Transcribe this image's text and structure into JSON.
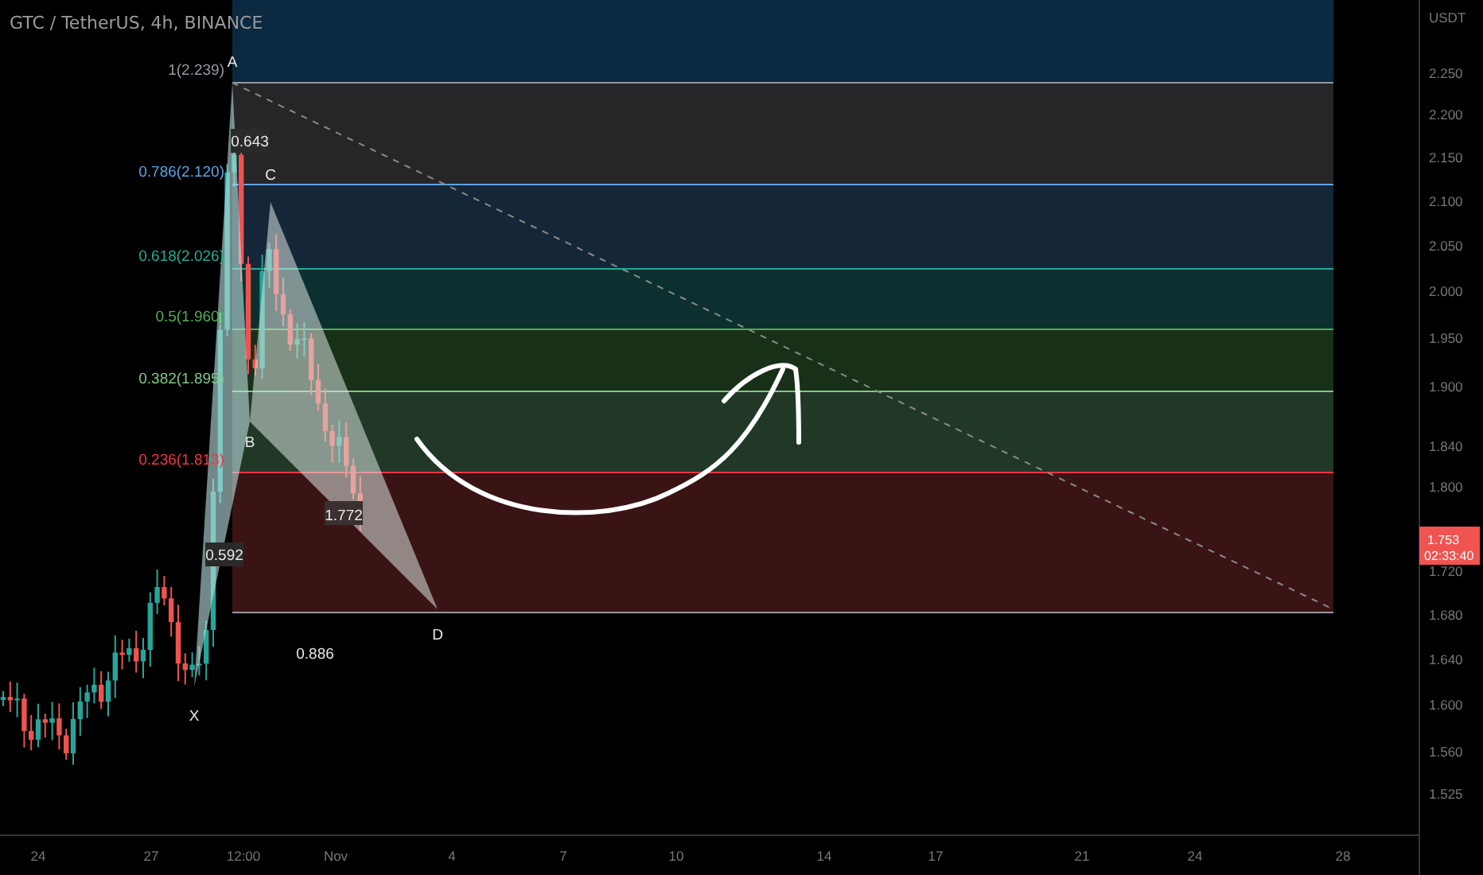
{
  "header": {
    "symbol": "GTC / TetherUS, 4h, BINANCE"
  },
  "price_axis": {
    "unit": "USDT",
    "ticks": [
      "2.250",
      "2.200",
      "2.150",
      "2.100",
      "2.050",
      "2.000",
      "1.950",
      "1.900",
      "1.840",
      "1.800",
      "1.720",
      "1.680",
      "1.640",
      "1.600",
      "1.560",
      "1.525"
    ],
    "last_price": {
      "value": "1.753",
      "countdown": "02:33:40",
      "color": "#f05350"
    }
  },
  "time_axis": {
    "ticks": [
      "24",
      "27",
      "12:00",
      "Nov",
      "4",
      "7",
      "10",
      "14",
      "17",
      "21",
      "24",
      "28"
    ]
  },
  "fib_levels": [
    {
      "label": "1(2.239)",
      "color": "#9598a1"
    },
    {
      "label": "0.786(2.120)",
      "color": "#5ba4e6"
    },
    {
      "label": "0.618(2.026)",
      "color": "#22ab94"
    },
    {
      "label": "0.5(1.960)",
      "color": "#4caf50"
    },
    {
      "label": "0.382(1.895)",
      "color": "#81c784"
    },
    {
      "label": "0.236(1.813)",
      "color": "#f23645"
    }
  ],
  "pattern_points": [
    "X",
    "A",
    "B",
    "C",
    "D"
  ],
  "ratios": [
    "0.643",
    "0.592",
    "0.886"
  ],
  "price_label": "1.772"
}
